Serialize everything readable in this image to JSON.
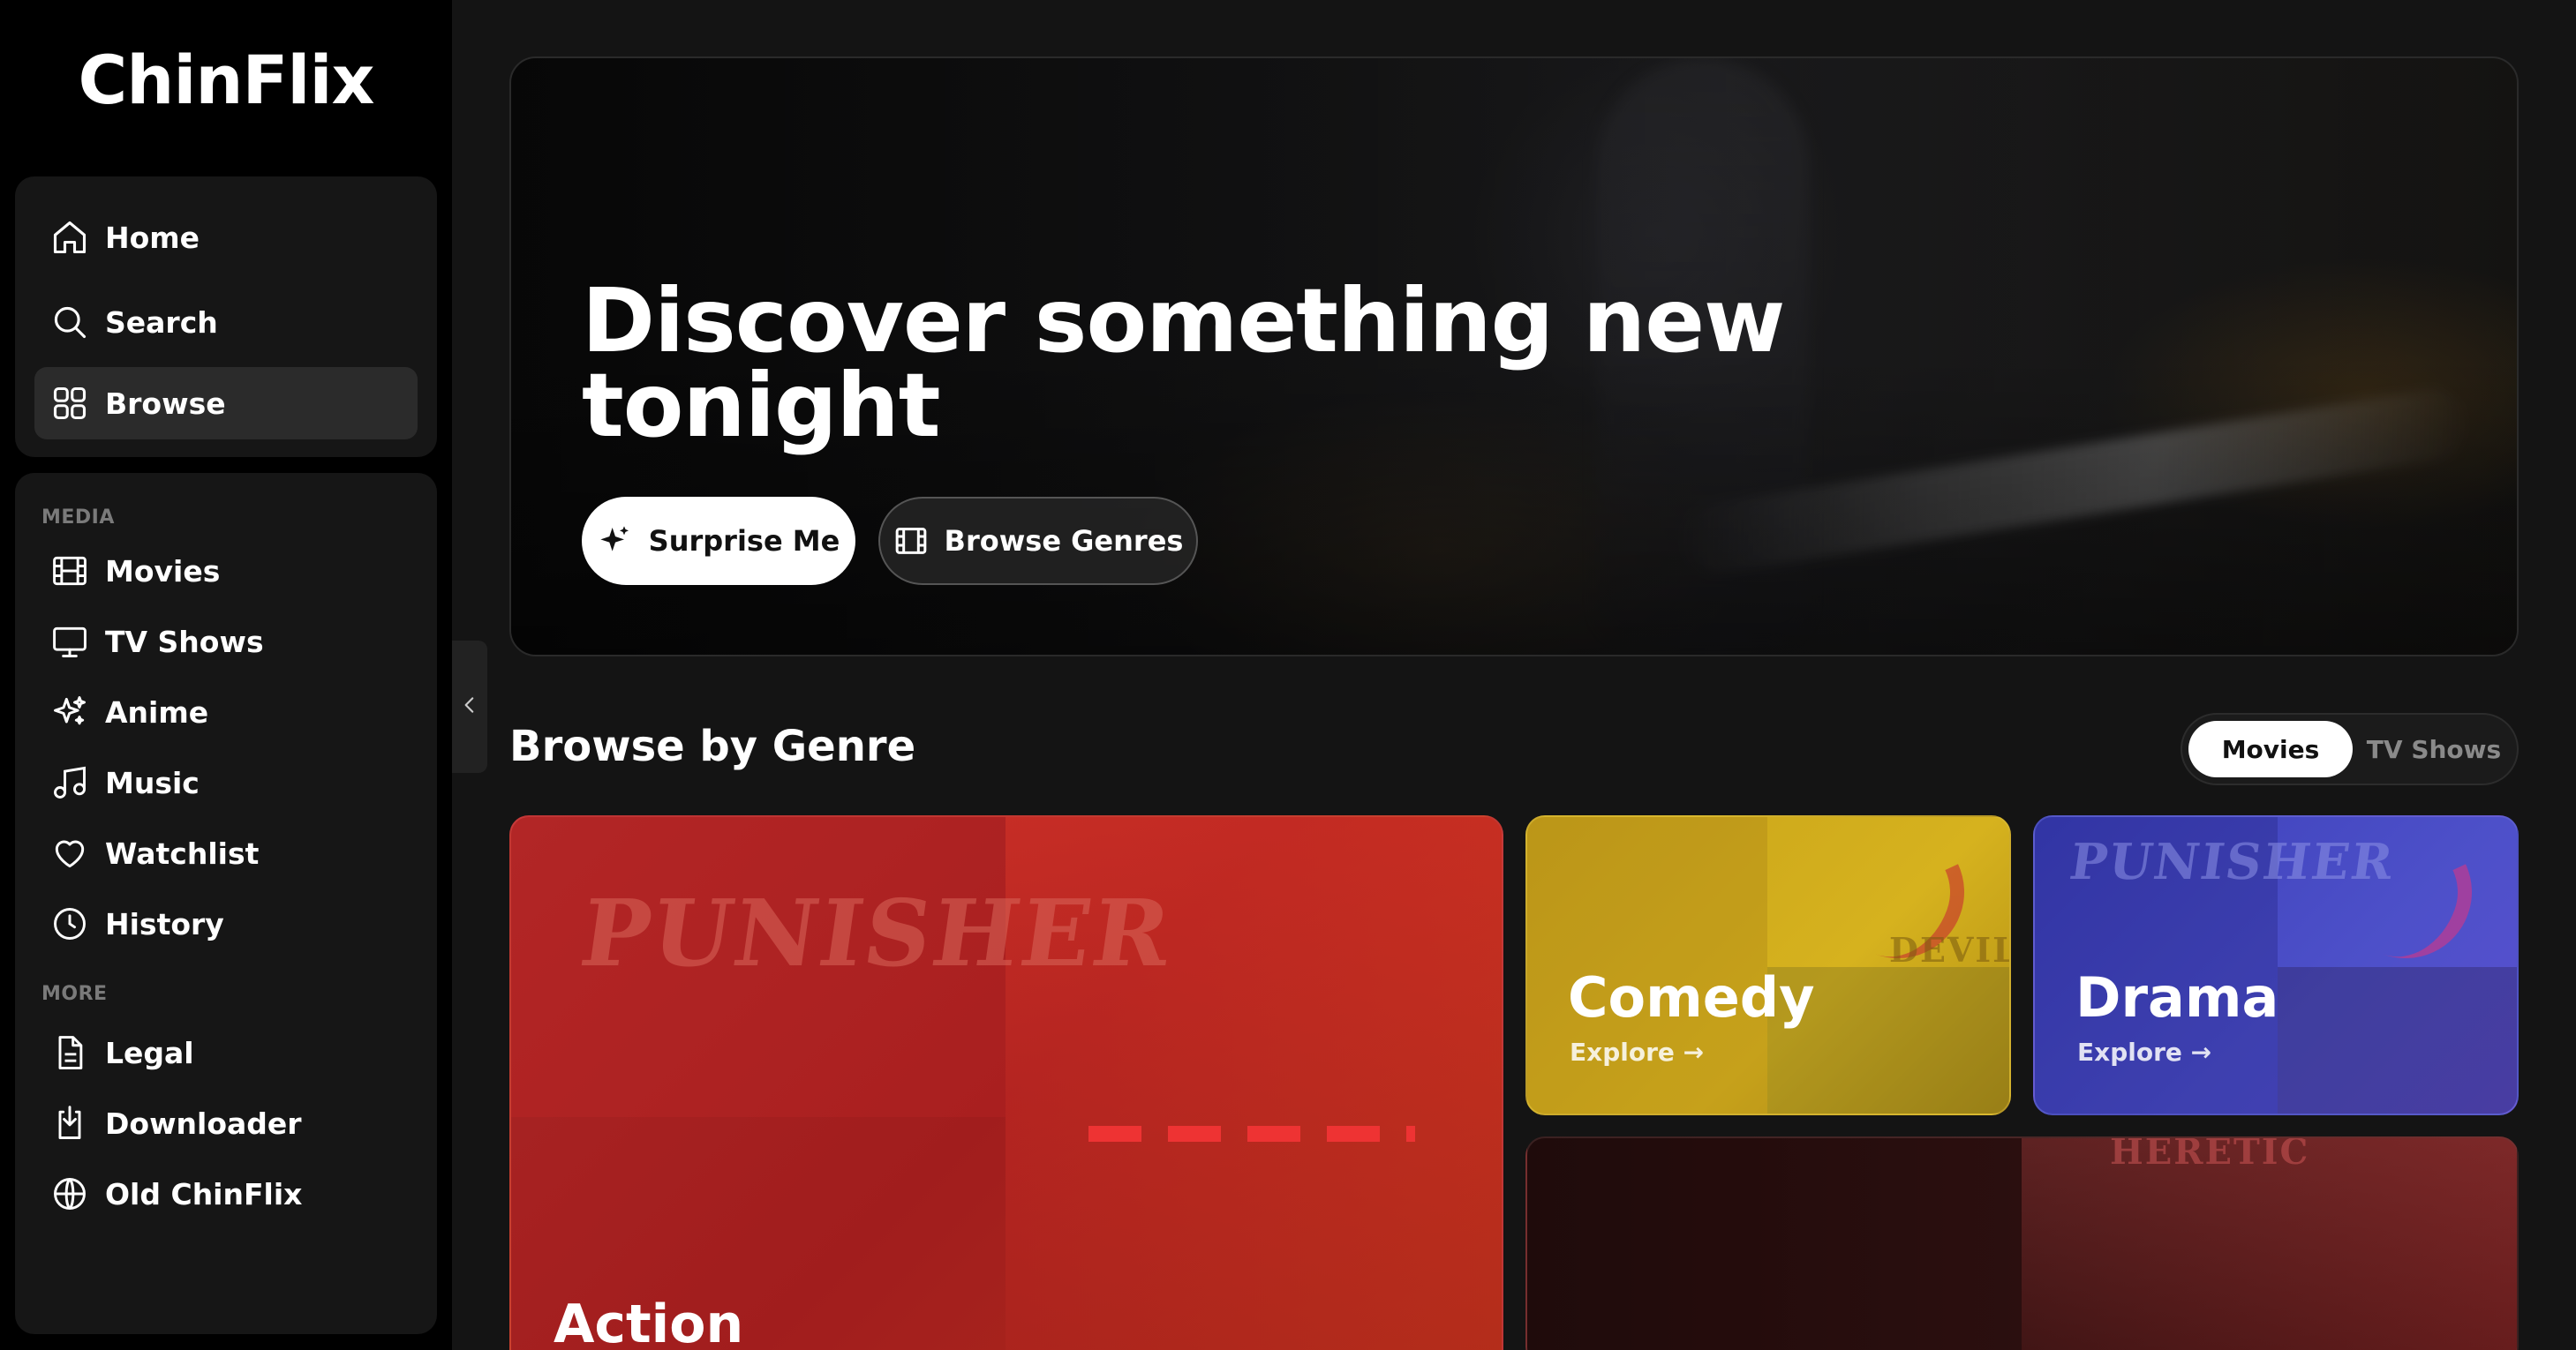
{
  "app": {
    "logo": "ChinFlix"
  },
  "sidebar": {
    "primary": [
      {
        "label": "Home",
        "icon": "home-icon"
      },
      {
        "label": "Search",
        "icon": "search-icon"
      },
      {
        "label": "Browse",
        "icon": "grid-icon",
        "active": true
      }
    ],
    "media_label": "MEDIA",
    "media": [
      {
        "label": "Movies",
        "icon": "film-icon"
      },
      {
        "label": "TV Shows",
        "icon": "tv-icon"
      },
      {
        "label": "Anime",
        "icon": "sparkles-icon"
      },
      {
        "label": "Music",
        "icon": "music-icon"
      },
      {
        "label": "Watchlist",
        "icon": "heart-icon"
      },
      {
        "label": "History",
        "icon": "clock-icon"
      }
    ],
    "more_label": "MORE",
    "more": [
      {
        "label": "Legal",
        "icon": "document-icon"
      },
      {
        "label": "Downloader",
        "icon": "download-icon"
      },
      {
        "label": "Old ChinFlix",
        "icon": "globe-icon"
      }
    ]
  },
  "hero": {
    "title": "Discover something new tonight",
    "primary_button": "Surprise Me",
    "secondary_button": "Browse Genres"
  },
  "genres": {
    "title": "Browse by Genre",
    "toggle": {
      "selected": "Movies",
      "other": "TV Shows"
    },
    "explore_label": "Explore →",
    "cards": [
      {
        "name": "Action",
        "color": "#c22a2a",
        "poster_text": "PUNISHER"
      },
      {
        "name": "Comedy",
        "color": "#d6b21e",
        "poster_text": "DEVIL"
      },
      {
        "name": "Drama",
        "color": "#4d50c9",
        "poster_text": "PUNISHER"
      },
      {
        "name": "",
        "color": "#3a1414",
        "poster_text": "HERETIC"
      }
    ]
  },
  "colors": {
    "background": "#141414",
    "sidebar": "#000000",
    "accent": "#ffffff"
  }
}
